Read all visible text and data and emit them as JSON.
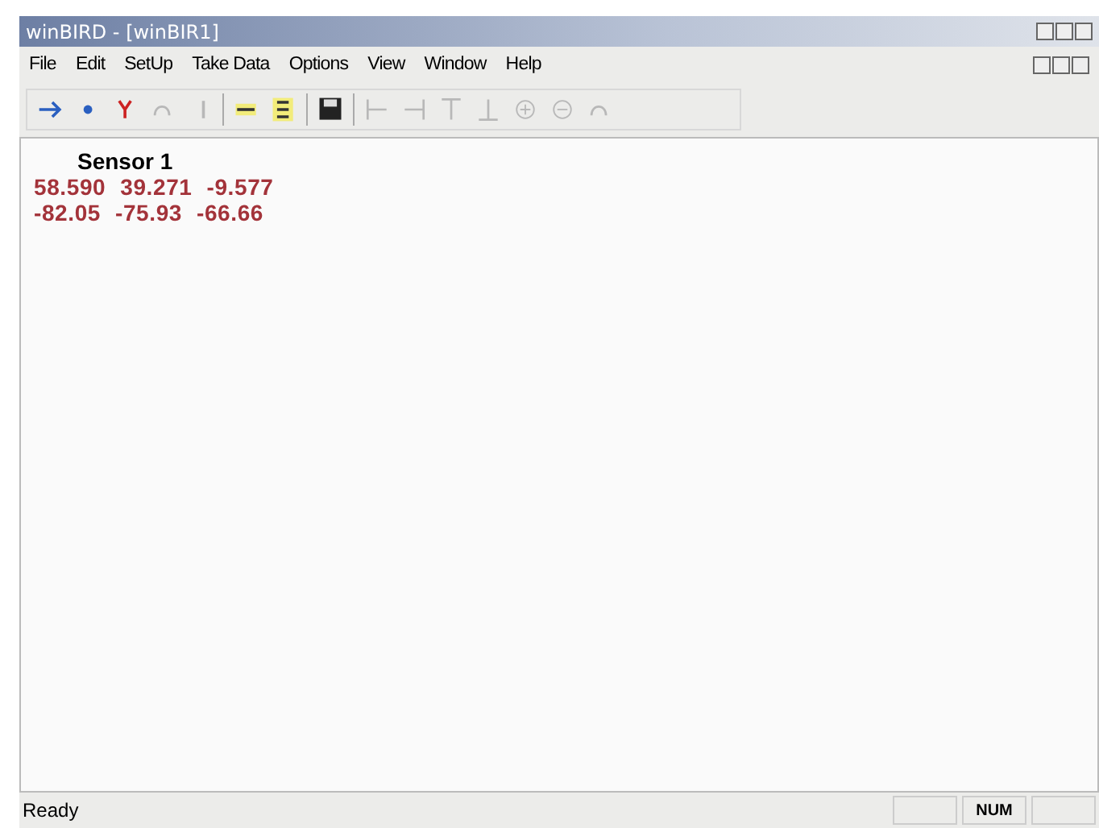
{
  "window": {
    "title": "winBIRD - [winBIR1]"
  },
  "menu": [
    "File",
    "Edit",
    "SetUp",
    "Take Data",
    "Options",
    "View",
    "Window",
    "Help"
  ],
  "toolbar": [
    {
      "kind": "arrow",
      "disabled": false
    },
    {
      "kind": "dot",
      "disabled": false
    },
    {
      "kind": "fork",
      "disabled": false
    },
    {
      "kind": "curve",
      "disabled": true
    },
    {
      "kind": "bar",
      "disabled": true
    },
    {
      "kind": "sep"
    },
    {
      "kind": "dash",
      "disabled": false
    },
    {
      "kind": "list",
      "disabled": false
    },
    {
      "kind": "sep"
    },
    {
      "kind": "disk",
      "disabled": false
    },
    {
      "kind": "sep"
    },
    {
      "kind": "left-stop",
      "disabled": true
    },
    {
      "kind": "right-stop",
      "disabled": true
    },
    {
      "kind": "top-stop",
      "disabled": true
    },
    {
      "kind": "bottom-stop",
      "disabled": true
    },
    {
      "kind": "plus",
      "disabled": true
    },
    {
      "kind": "minus",
      "disabled": true
    },
    {
      "kind": "curve",
      "disabled": true
    }
  ],
  "document": {
    "heading": "Sensor 1",
    "rows": [
      [
        "58.590",
        "39.271",
        "-9.577"
      ],
      [
        "-82.05",
        "-75.93",
        "-66.66"
      ]
    ]
  },
  "status_bar": {
    "message": "Ready",
    "indicators": [
      {
        "kind": "empty"
      },
      {
        "kind": "text",
        "label": "NUM"
      },
      {
        "kind": "empty"
      }
    ]
  }
}
